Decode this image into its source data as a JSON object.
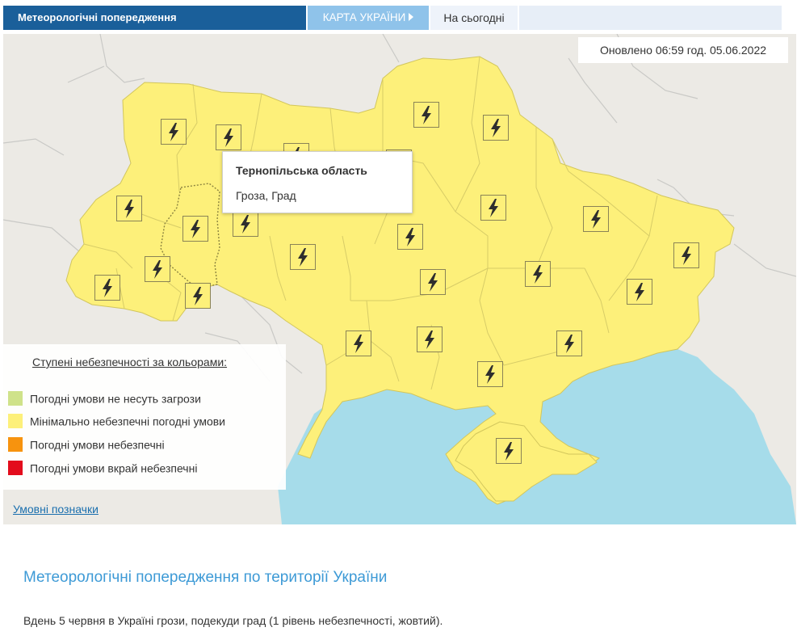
{
  "tabs": {
    "main": "Метеорологічні попередження",
    "map": "КАРТА УКРАЇНИ",
    "today": "На сьогодні"
  },
  "map": {
    "updated": "Оновлено 06:59 год. 05.06.2022",
    "tooltip": {
      "title": "Тернопільська область",
      "text": "Гроза, Град"
    },
    "icon": "lightning-icon",
    "colors": {
      "land": "#fdf07a",
      "sea": "#a6dcea",
      "background": "#eceae5",
      "border": "#c8bb50"
    }
  },
  "legend": {
    "title": "Ступені небезпечності за кольорами:",
    "items": [
      {
        "label": "Погодні умови не несуть загрози",
        "color": "#cfe28a"
      },
      {
        "label": "Мінімально небезпечні погодні умови",
        "color": "#fdf07a"
      },
      {
        "label": "Погодні умови небезпечні",
        "color": "#f7930e"
      },
      {
        "label": "Погодні умови вкрай небезпечні",
        "color": "#e30c1c"
      }
    ],
    "symbols_link": "Умовні позначки"
  },
  "content": {
    "heading": "Метеорологічні попередження по території України",
    "description": "Вдень 5 червня в Україні грози, подекуди град (1 рівень небезпечності, жовтий)."
  }
}
